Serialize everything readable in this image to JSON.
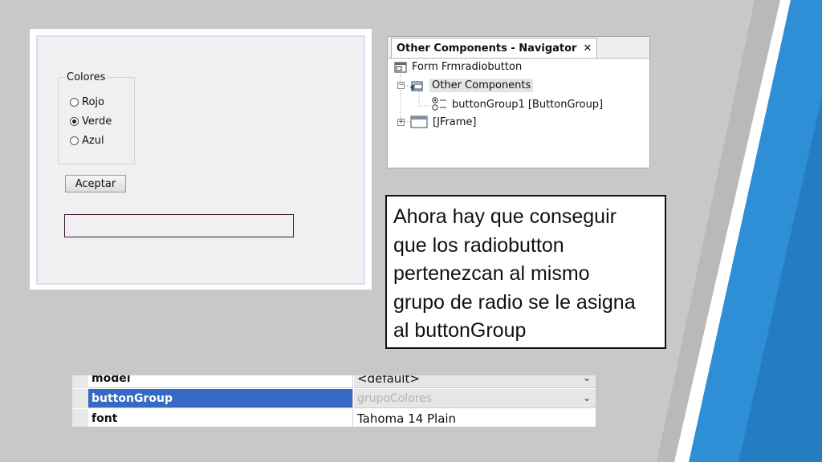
{
  "form": {
    "group_title": "Colores",
    "radios": [
      {
        "label": "Rojo",
        "checked": false
      },
      {
        "label": "Verde",
        "checked": true
      },
      {
        "label": "Azul",
        "checked": false
      }
    ],
    "accept_label": "Aceptar",
    "text_value": ""
  },
  "navigator": {
    "tab_title": "Other Components - Navigator",
    "close_glyph": "✕",
    "nodes": {
      "form": "Form Frmradiobutton",
      "other": "Other Components",
      "group": "buttonGroup1 [ButtonGroup]",
      "frame": "[JFrame]"
    }
  },
  "callout": {
    "lines": [
      "Ahora hay que conseguir",
      "que los radiobutton",
      "pertenezcan al mismo",
      "grupo de radio se le asigna",
      "al buttonGroup"
    ]
  },
  "properties": {
    "rows": [
      {
        "name": "model",
        "value": "<default>",
        "has_dropdown": true
      },
      {
        "name": "buttonGroup",
        "value": "grupoColores",
        "has_dropdown": true,
        "selected": true
      },
      {
        "name": "font",
        "value": "Tahoma 14 Plain",
        "has_dropdown": false
      }
    ]
  },
  "colors": {
    "background": "#c8c8c8",
    "accent_blue": "#2e8fd6",
    "selection_blue": "#3469c4"
  }
}
